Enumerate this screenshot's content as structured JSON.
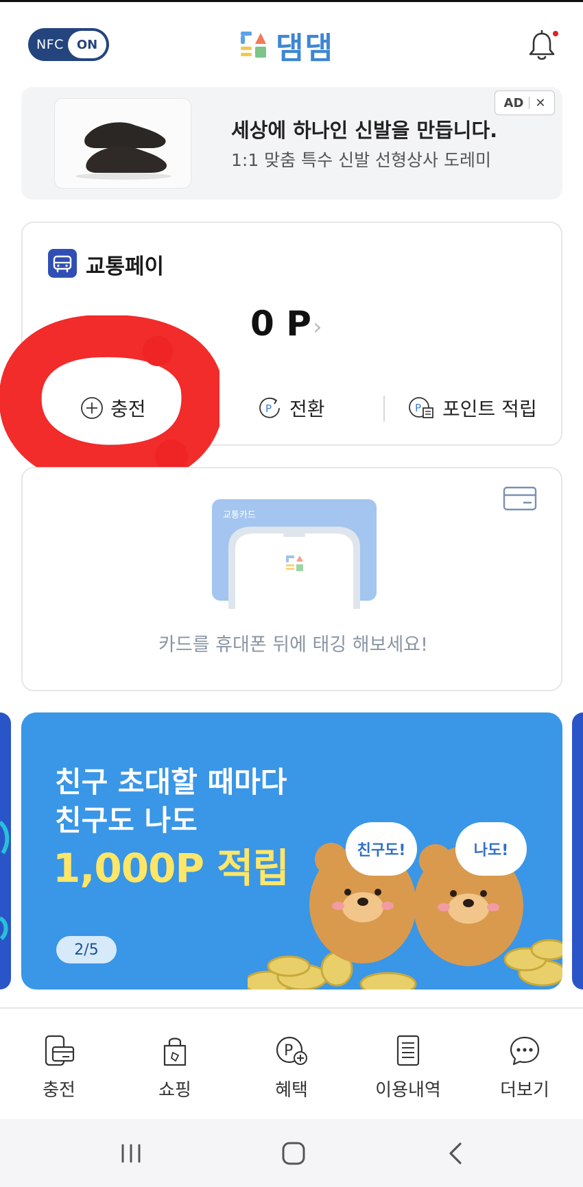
{
  "header": {
    "nfc_label": "NFC",
    "nfc_state": "ON",
    "logo_text": "댐댐"
  },
  "ad": {
    "title": "세상에 하나인 신발을 만듭니다.",
    "subtitle": "1:1 맞춤 특수 신발 선형상사 도레미",
    "badge": "AD",
    "close": "✕"
  },
  "pay": {
    "title": "교통페이",
    "amount": "0 P",
    "chevron": "›",
    "actions": {
      "charge": "충전",
      "convert": "전환",
      "earn": "포인트 적립"
    }
  },
  "transit_card": {
    "card_label": "교통카드",
    "instruction": "카드를 휴대폰 뒤에 태깅 해보세요!"
  },
  "banner": {
    "line1": "친구 초대할 때마다",
    "line2": "친구도 나도",
    "line3": "1,000P 적립",
    "bubble_left": "친구도!",
    "bubble_right": "나도!",
    "pager": "2/5"
  },
  "bottom_nav": {
    "items": [
      {
        "label": "충전",
        "icon": "card-device-icon"
      },
      {
        "label": "쇼핑",
        "icon": "shopping-bag-icon"
      },
      {
        "label": "혜택",
        "icon": "point-plus-icon"
      },
      {
        "label": "이용내역",
        "icon": "receipt-icon"
      },
      {
        "label": "더보기",
        "icon": "chat-more-icon"
      }
    ]
  },
  "colors": {
    "brand_blue": "#3e86d4",
    "nfc_bg": "#24447e",
    "banner_bg": "#3a96e6",
    "banner_highlight": "#ffe667",
    "annotation_red": "#f22b2b"
  }
}
